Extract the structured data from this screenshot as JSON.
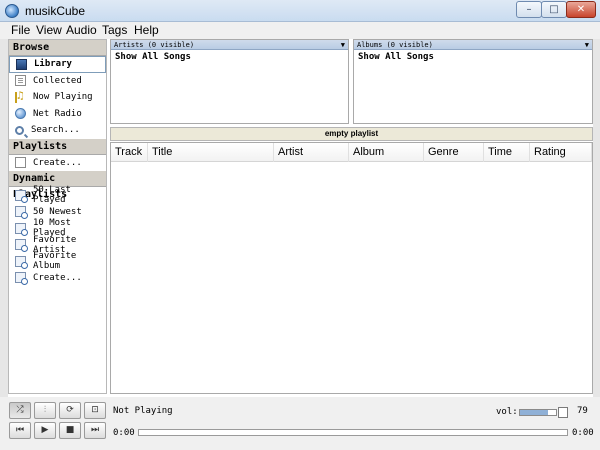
{
  "window": {
    "title": "musikCube",
    "minimize_label": "–",
    "maximize_label": "□",
    "close_label": "✕",
    "icon": "app-icon"
  },
  "menu": [
    "File",
    "View",
    "Audio",
    "Tags",
    "Help"
  ],
  "sidebar": {
    "browse_header": "Browse",
    "browse_items": [
      {
        "label": "Library",
        "icon": "library-icon",
        "selected": true
      },
      {
        "label": "Collected",
        "icon": "collected-icon"
      },
      {
        "label": "Now Playing",
        "icon": "now-playing-icon"
      },
      {
        "label": "Net Radio",
        "icon": "net-radio-icon"
      },
      {
        "label": "Search...",
        "icon": "search-icon"
      }
    ],
    "playlists_header": "Playlists",
    "playlists_items": [
      {
        "label": "Create...",
        "icon": "create-icon"
      }
    ],
    "dynamic_header": "Dynamic Playlists",
    "dynamic_items": [
      {
        "label": "50 Last Played",
        "icon": "dynamic-playlist-icon"
      },
      {
        "label": "50 Newest",
        "icon": "dynamic-playlist-icon"
      },
      {
        "label": "10 Most Played",
        "icon": "dynamic-playlist-icon"
      },
      {
        "label": "Favorite Artist",
        "icon": "dynamic-playlist-icon"
      },
      {
        "label": "Favorite Album",
        "icon": "dynamic-playlist-icon"
      },
      {
        "label": "Create...",
        "icon": "dynamic-playlist-icon"
      }
    ]
  },
  "artists_pane": {
    "header": "Artists (0 visible)",
    "row": "Show All Songs"
  },
  "albums_pane": {
    "header": "Albums (0 visible)",
    "row": "Show All Songs"
  },
  "playlist": {
    "title": "empty playlist",
    "columns": [
      "Track",
      "Title",
      "Artist",
      "Album",
      "Genre",
      "Time",
      "Rating"
    ]
  },
  "player": {
    "status": "Not Playing",
    "vol_label": "vol:",
    "volume": 79,
    "time_current": "0:00",
    "time_total": "0:00",
    "progress": 0,
    "buttons_top": [
      {
        "name": "shuffle-button",
        "icon": "shuffle-icon",
        "glyph": "⤮",
        "pressed": true
      },
      {
        "name": "equalizer-button",
        "icon": "equalizer-icon",
        "glyph": "⫶"
      },
      {
        "name": "repeat-button",
        "icon": "repeat-icon",
        "glyph": "⟳"
      },
      {
        "name": "crossfade-button",
        "icon": "crossfade-icon",
        "glyph": "⊡"
      }
    ],
    "buttons_bottom": [
      {
        "name": "previous-button",
        "icon": "previous-icon",
        "glyph": "⏮"
      },
      {
        "name": "play-button",
        "icon": "play-icon",
        "glyph": "▶"
      },
      {
        "name": "stop-button",
        "icon": "stop-icon",
        "glyph": "■"
      },
      {
        "name": "next-button",
        "icon": "next-icon",
        "glyph": "⏭"
      }
    ]
  }
}
